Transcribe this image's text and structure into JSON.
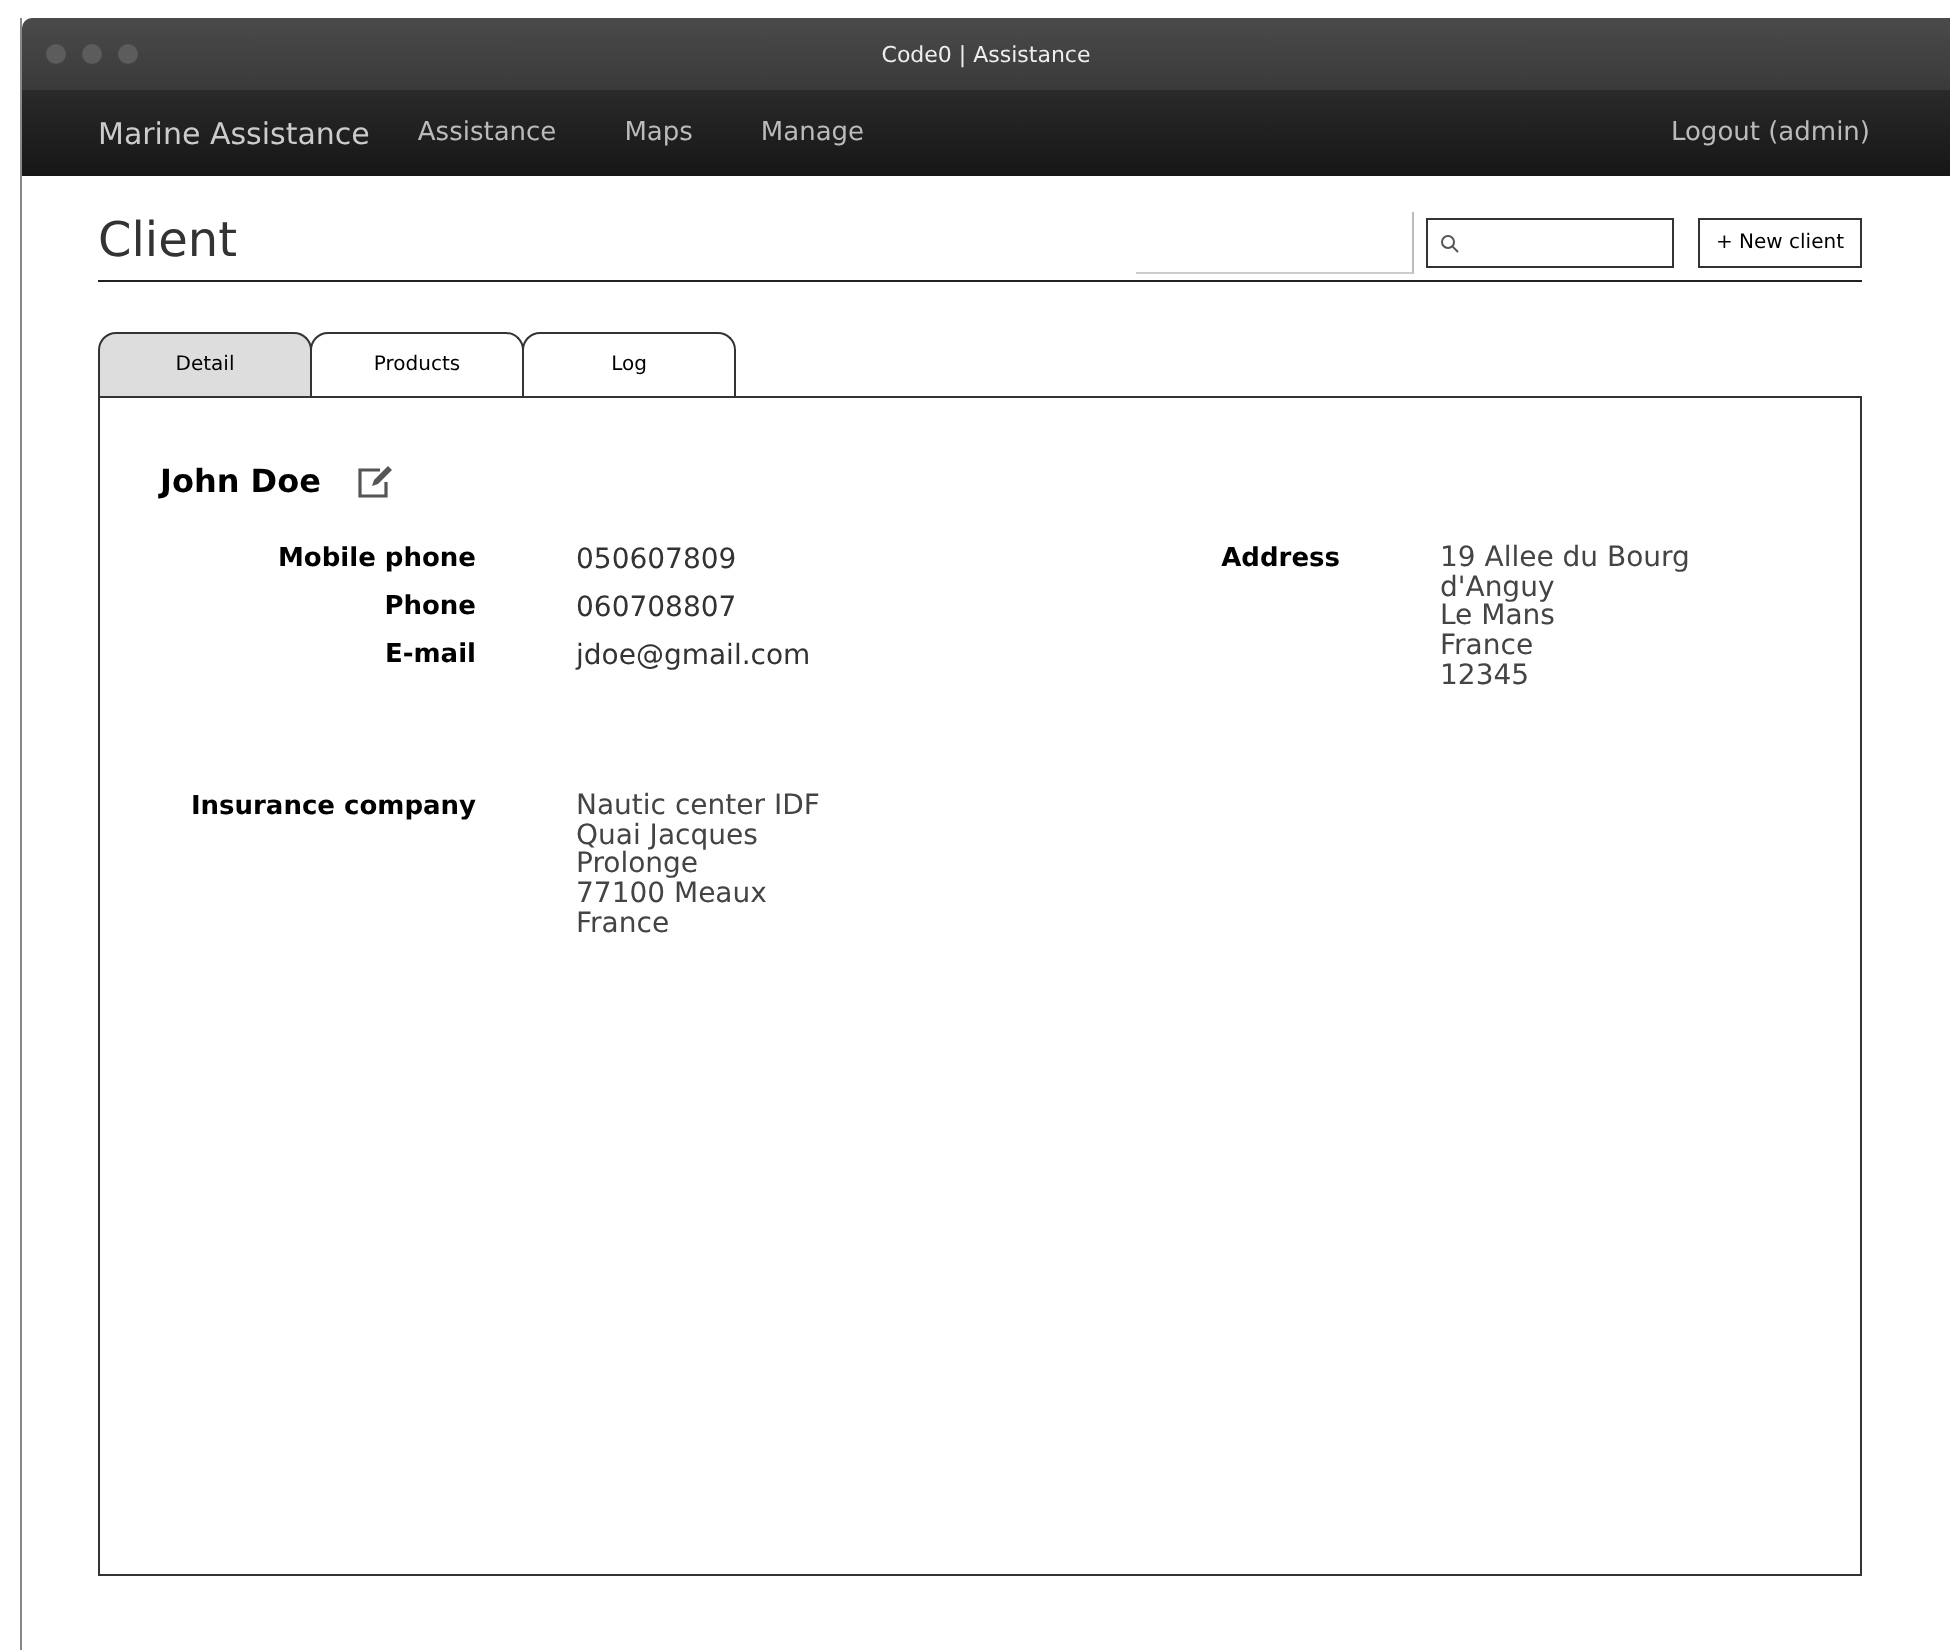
{
  "window": {
    "title": "Code0 | Assistance"
  },
  "nav": {
    "brand": "Marine Assistance",
    "items": [
      {
        "label": "Assistance"
      },
      {
        "label": "Maps"
      },
      {
        "label": "Manage"
      }
    ],
    "logout": "Logout (admin)"
  },
  "page": {
    "title": "Client",
    "new_button": "+ New client"
  },
  "tabs": [
    {
      "label": "Detail",
      "selected": true
    },
    {
      "label": "Products",
      "selected": false
    },
    {
      "label": "Log",
      "selected": false
    }
  ],
  "client": {
    "name": "John Doe",
    "contacts": [
      {
        "label": "Mobile phone",
        "value": "050607809"
      },
      {
        "label": "Phone",
        "value": "060708807"
      },
      {
        "label": "E-mail",
        "value": "jdoe@gmail.com"
      }
    ],
    "address": {
      "label": "Address",
      "lines": [
        "19 Allee du Bourg",
        "d'Anguy",
        "Le Mans",
        "France",
        "12345"
      ]
    },
    "insurance": {
      "label": "Insurance company",
      "lines": [
        "Nautic center IDF",
        "Quai Jacques",
        "Prolonge",
        "77100 Meaux",
        "France"
      ]
    }
  }
}
